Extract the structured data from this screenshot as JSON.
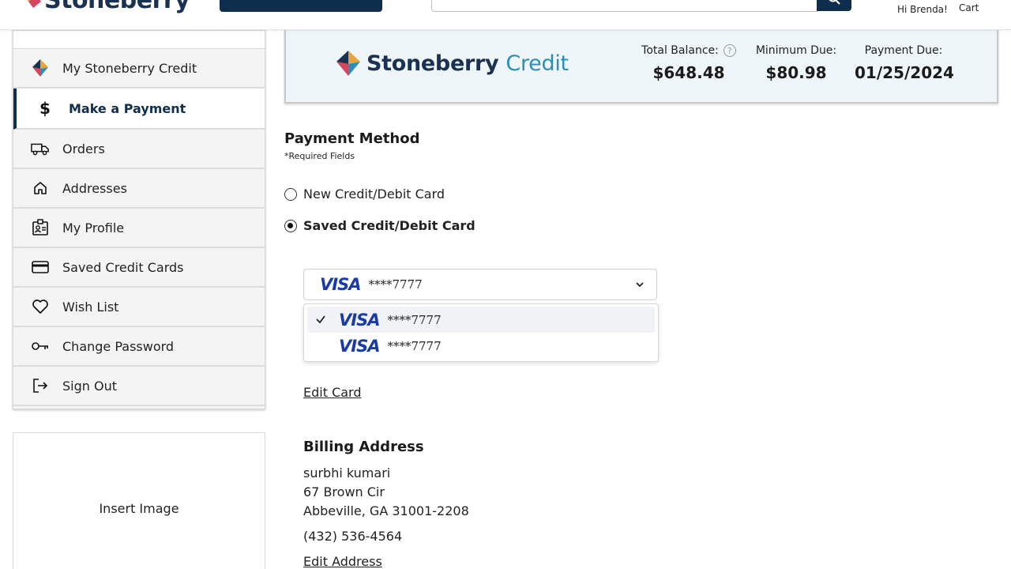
{
  "header": {
    "logo_text": "Stoneberry",
    "greeting": "Hi Brenda!",
    "cart_label": "Cart"
  },
  "sidebar": {
    "items": [
      {
        "label": "My Stoneberry Credit",
        "icon": "stoneberry-logo-icon"
      },
      {
        "label": "Make a Payment",
        "icon": "dollar-icon",
        "active": true
      },
      {
        "label": "Orders",
        "icon": "truck-icon"
      },
      {
        "label": "Addresses",
        "icon": "home-icon"
      },
      {
        "label": "My Profile",
        "icon": "id-badge-icon"
      },
      {
        "label": "Saved Credit Cards",
        "icon": "credit-card-icon"
      },
      {
        "label": "Wish List",
        "icon": "heart-icon"
      },
      {
        "label": "Change Password",
        "icon": "key-icon"
      },
      {
        "label": "Sign Out",
        "icon": "sign-out-icon"
      }
    ],
    "insert_image": "Insert Image"
  },
  "banner": {
    "brand": "Stoneberry",
    "brand_suffix": "Credit",
    "total_balance_label": "Total Balance:",
    "total_balance": "$648.48",
    "minimum_due_label": "Minimum Due:",
    "minimum_due": "$80.98",
    "payment_due_label": "Payment Due:",
    "payment_due": "01/25/2024"
  },
  "payment": {
    "title": "Payment Method",
    "required_note": "*Required Fields",
    "options": [
      {
        "label": "New Credit/Debit Card",
        "selected": false
      },
      {
        "label": "Saved Credit/Debit Card",
        "selected": true
      }
    ],
    "selected_card": {
      "brand": "VISA",
      "number": "****7777"
    },
    "dropdown_options": [
      {
        "brand": "VISA",
        "number": "****7777",
        "checked": true
      },
      {
        "brand": "VISA",
        "number": "****7777",
        "checked": false
      }
    ],
    "edit_card": "Edit Card"
  },
  "billing": {
    "title": "Billing Address",
    "name": "surbhi kumari",
    "street": "67 Brown Cir",
    "city_line": "Abbeville, GA 31001-2208",
    "phone": "(432) 536-4564",
    "edit_address": "Edit Address"
  },
  "colors": {
    "navy": "#0f2e4d",
    "visa_blue": "#1a3aa8",
    "banner_bg": "#eef6f9"
  }
}
